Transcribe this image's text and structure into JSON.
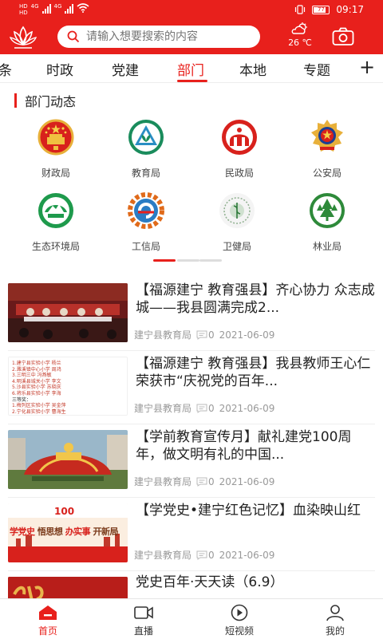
{
  "status_bar": {
    "network_left": [
      "HD",
      "HD"
    ],
    "network_types": [
      "4G",
      "4G"
    ],
    "battery": "77",
    "time": "09:17",
    "icons": [
      "vibrate-icon",
      "battery-icon",
      "wifi-icon",
      "signal-icon"
    ]
  },
  "header": {
    "search_placeholder": "请输入想要搜索的内容",
    "temperature": "26 ℃",
    "weather_icon": "cloudy-sun-icon",
    "camera_icon": "camera-icon",
    "logo_icon": "lotus-logo-icon"
  },
  "tabs": [
    {
      "label": "条"
    },
    {
      "label": "时政"
    },
    {
      "label": "党建"
    },
    {
      "label": "部门",
      "active": true
    },
    {
      "label": "本地"
    },
    {
      "label": "专题"
    }
  ],
  "tab_plus": "+",
  "section": {
    "title": "部门动态"
  },
  "departments": [
    {
      "name": "财政局",
      "icon": "national-emblem-icon"
    },
    {
      "name": "教育局",
      "icon": "education-emblem-icon"
    },
    {
      "name": "民政局",
      "icon": "civil-affairs-emblem-icon"
    },
    {
      "name": "公安局",
      "icon": "police-emblem-icon"
    },
    {
      "name": "生态环境局",
      "icon": "ecology-emblem-icon"
    },
    {
      "name": "工信局",
      "icon": "industry-emblem-icon"
    },
    {
      "name": "卫健局",
      "icon": "health-emblem-icon"
    },
    {
      "name": "林业局",
      "icon": "forestry-emblem-icon"
    }
  ],
  "news": [
    {
      "title": "【福源建宁 教育强县】齐心协力 众志成城——我县圆满完成2...",
      "source": "建宁县教育局",
      "comments": "0",
      "date": "2021-06-09",
      "thumb": "meeting-hall"
    },
    {
      "title": "【福源建宁 教育强县】我县教师王心仁荣获市“庆祝党的百年...",
      "source": "建宁县教育局",
      "comments": "0",
      "date": "2021-06-09",
      "thumb": "award-list",
      "thumb_text": [
        "1.建宁县实验小学 杨兰",
        "2.濉溪镇中心小学 周鸿",
        "3.三明三中 冯燕敏",
        "4.明溪县城关小学 李文",
        "5.沙县实验小学 苏晓庆",
        "6.将乐县实验小学 李海",
        "三等奖：",
        "1.梅列区实验小学 吴金萍",
        "2.宁化县实验小学 曹海生"
      ]
    },
    {
      "title": "【学前教育宣传月】献礼建党100周年，做文明有礼的中国...",
      "source": "建宁县教育局",
      "comments": "0",
      "date": "2021-06-09",
      "thumb": "party-sculpture"
    },
    {
      "title": "【学党史•建宁红色记忆】血染映山红",
      "source": "建宁县教育局",
      "comments": "0",
      "date": "2021-06-09",
      "thumb": "party-poster",
      "thumb_text": [
        "学党史",
        "悟思想",
        "办实事",
        "开新局"
      ]
    },
    {
      "title": "党史百年·天天读（6.9）",
      "thumb": "calligraphy"
    }
  ],
  "bottom_nav": [
    {
      "label": "首页",
      "icon": "home-icon",
      "active": true
    },
    {
      "label": "直播",
      "icon": "video-camera-icon"
    },
    {
      "label": "短视频",
      "icon": "play-circle-icon"
    },
    {
      "label": "我的",
      "icon": "user-icon"
    }
  ],
  "colors": {
    "brand": "#e8201c",
    "text": "#222222",
    "meta": "#999999"
  }
}
